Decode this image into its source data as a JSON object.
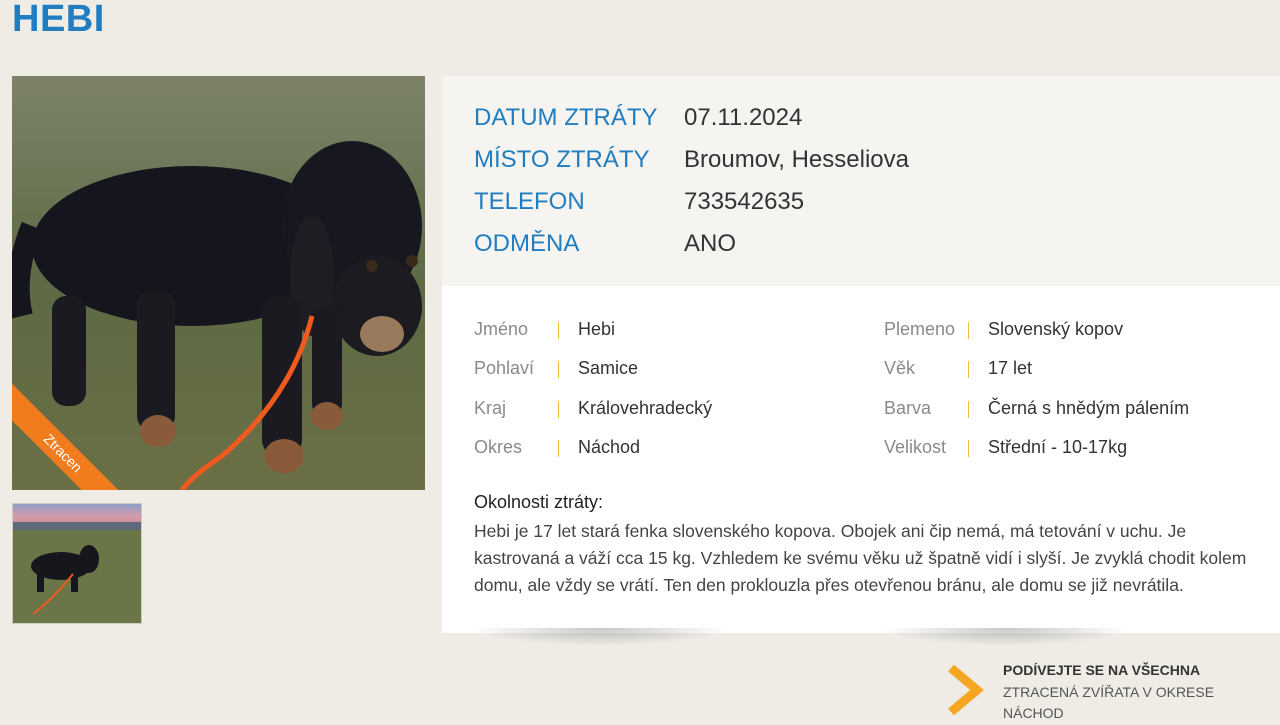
{
  "page": {
    "title": "HEBI"
  },
  "photo": {
    "ribbon": "Ztracen"
  },
  "key_info": [
    {
      "label": "DATUM ZTRÁTY",
      "value": "07.11.2024"
    },
    {
      "label": "MÍSTO ZTRÁTY",
      "value": "Broumov, Hesseliova"
    },
    {
      "label": "TELEFON",
      "value": "733542635"
    },
    {
      "label": "ODMĚNA",
      "value": "ANO"
    }
  ],
  "details_left": [
    {
      "label": "Jméno",
      "value": "Hebi"
    },
    {
      "label": "Pohlaví",
      "value": "Samice"
    },
    {
      "label": "Kraj",
      "value": "Královehradecký"
    },
    {
      "label": "Okres",
      "value": "Náchod"
    }
  ],
  "details_right": [
    {
      "label": "Plemeno",
      "value": "Slovenský kopov"
    },
    {
      "label": "Věk",
      "value": "17 let"
    },
    {
      "label": "Barva",
      "value": "Černá s hnědým pálením"
    },
    {
      "label": "Velikost",
      "value": "Střední - 10-17kg"
    }
  ],
  "circumstances": {
    "title": "Okolnosti ztráty:",
    "text": "Hebi je 17 let stará fenka slovenského kopova. Obojek ani čip nemá, má tetování v uchu. Je kastrovaná a váží cca 15 kg. Vzhledem ke svému věku už špatně vidí i slyší. Je zvyklá chodit kolem domu, ale vždy se vrátí. Ten den proklouzla přes otevřenou bránu, ale domu se již nevrátila."
  },
  "cta": {
    "strong": "PODÍVEJTE SE NA VŠECHNA",
    "sub": "ZTRACENÁ ZVÍŘATA V OKRESE NÁCHOD"
  },
  "colors": {
    "accent": "#1f7dc0",
    "ribbon": "#f07c1e",
    "separator": "#f0c23c",
    "cta_arrow": "#f5a623"
  }
}
